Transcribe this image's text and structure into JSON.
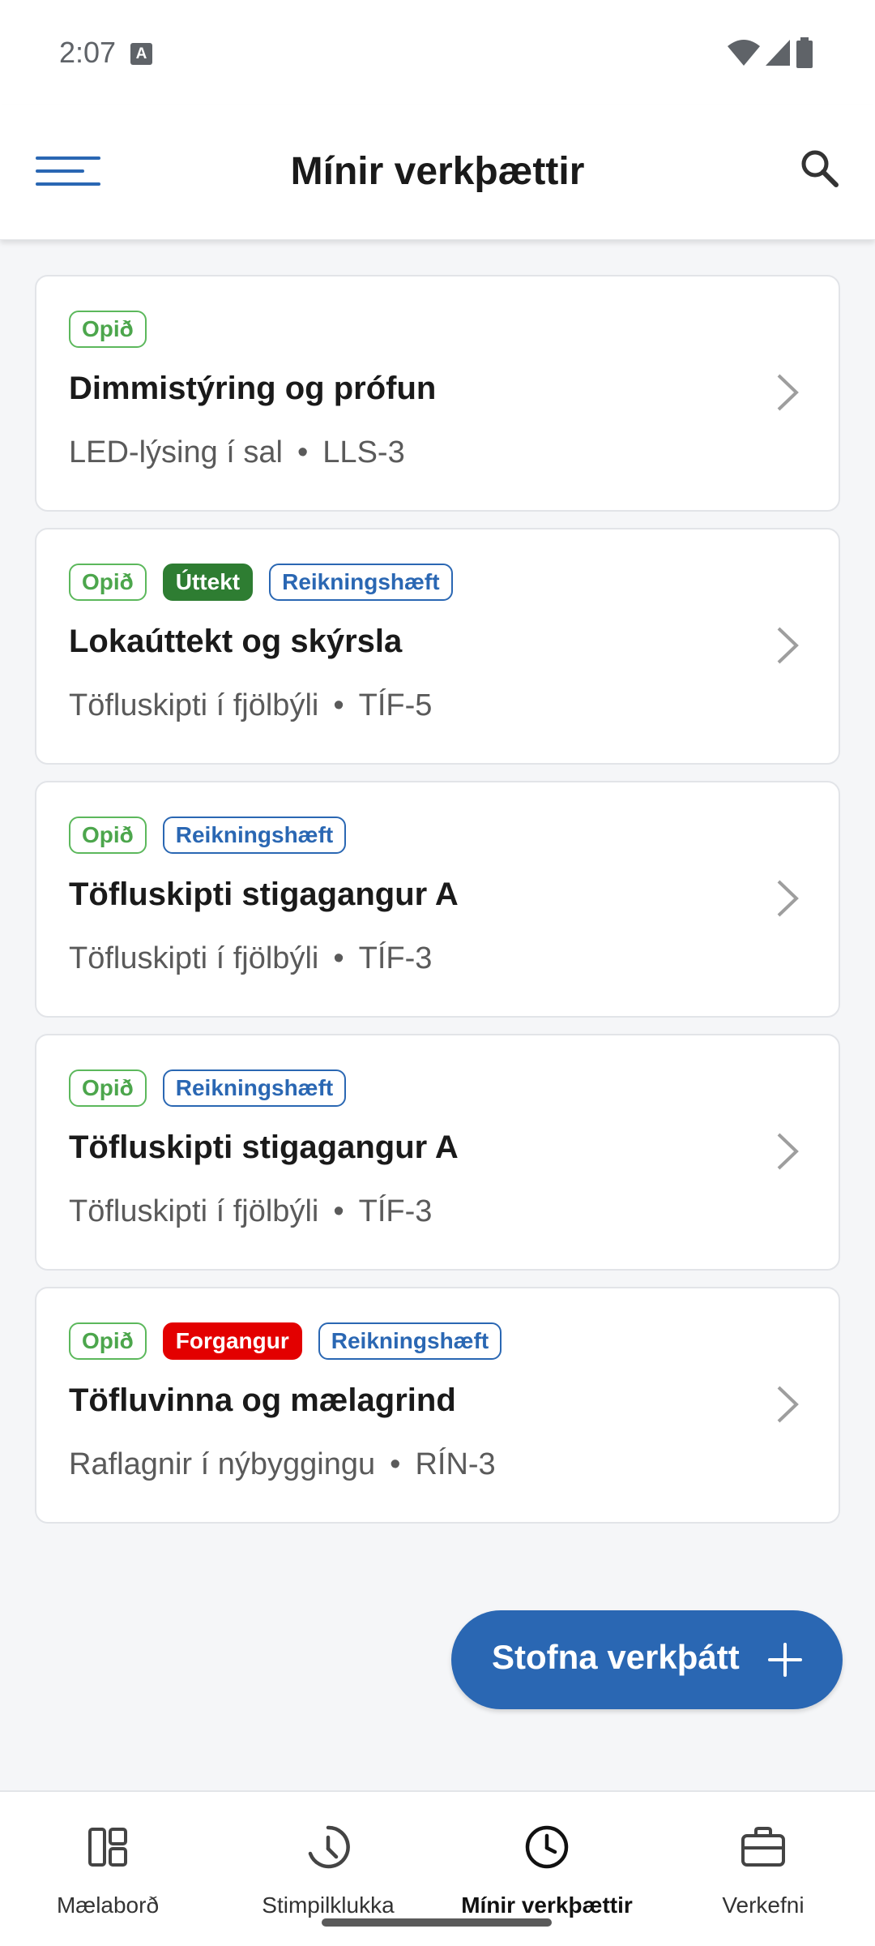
{
  "status_bar": {
    "time": "2:07",
    "notification_icon": "A"
  },
  "app_bar": {
    "title": "Mínir verkþættir"
  },
  "tasks": [
    {
      "badges": [
        {
          "label": "Opið",
          "kind": "open"
        }
      ],
      "title": "Dimmistýring og prófun",
      "project": "LED-lýsing í sal",
      "separator": "•",
      "code": "LLS-3"
    },
    {
      "badges": [
        {
          "label": "Opið",
          "kind": "open"
        },
        {
          "label": "Úttekt",
          "kind": "inspection"
        },
        {
          "label": "Reikningshæft",
          "kind": "billable"
        }
      ],
      "title": "Lokaúttekt og skýrsla",
      "project": "Töfluskipti í fjölbýli",
      "separator": "•",
      "code": "TÍF-5"
    },
    {
      "badges": [
        {
          "label": "Opið",
          "kind": "open"
        },
        {
          "label": "Reikningshæft",
          "kind": "billable"
        }
      ],
      "title": "Töfluskipti stigagangur A",
      "project": "Töfluskipti í fjölbýli",
      "separator": "•",
      "code": "TÍF-3"
    },
    {
      "badges": [
        {
          "label": "Opið",
          "kind": "open"
        },
        {
          "label": "Reikningshæft",
          "kind": "billable"
        }
      ],
      "title": "Töfluskipti stigagangur A",
      "project": "Töfluskipti í fjölbýli",
      "separator": "•",
      "code": "TÍF-3"
    },
    {
      "badges": [
        {
          "label": "Opið",
          "kind": "open"
        },
        {
          "label": "Forgangur",
          "kind": "priority"
        },
        {
          "label": "Reikningshæft",
          "kind": "billable"
        }
      ],
      "title": "Töfluvinna og mælagrind",
      "project": "Raflagnir í nýbyggingu",
      "separator": "•",
      "code": "RÍN-3"
    }
  ],
  "fab": {
    "label": "Stofna verkþátt",
    "icon": "plus-icon"
  },
  "bottom_nav": [
    {
      "label": "Mælaborð",
      "icon": "dashboard-icon",
      "active": false
    },
    {
      "label": "Stimpilklukka",
      "icon": "time-clock-icon",
      "active": false
    },
    {
      "label": "Mínir verkþættir",
      "icon": "clock-icon",
      "active": true
    },
    {
      "label": "Verkefni",
      "icon": "briefcase-icon",
      "active": false
    }
  ],
  "colors": {
    "accent": "#2a67b3",
    "open": "#4ca64c",
    "inspection": "#2e7d32",
    "priority": "#e30000"
  }
}
